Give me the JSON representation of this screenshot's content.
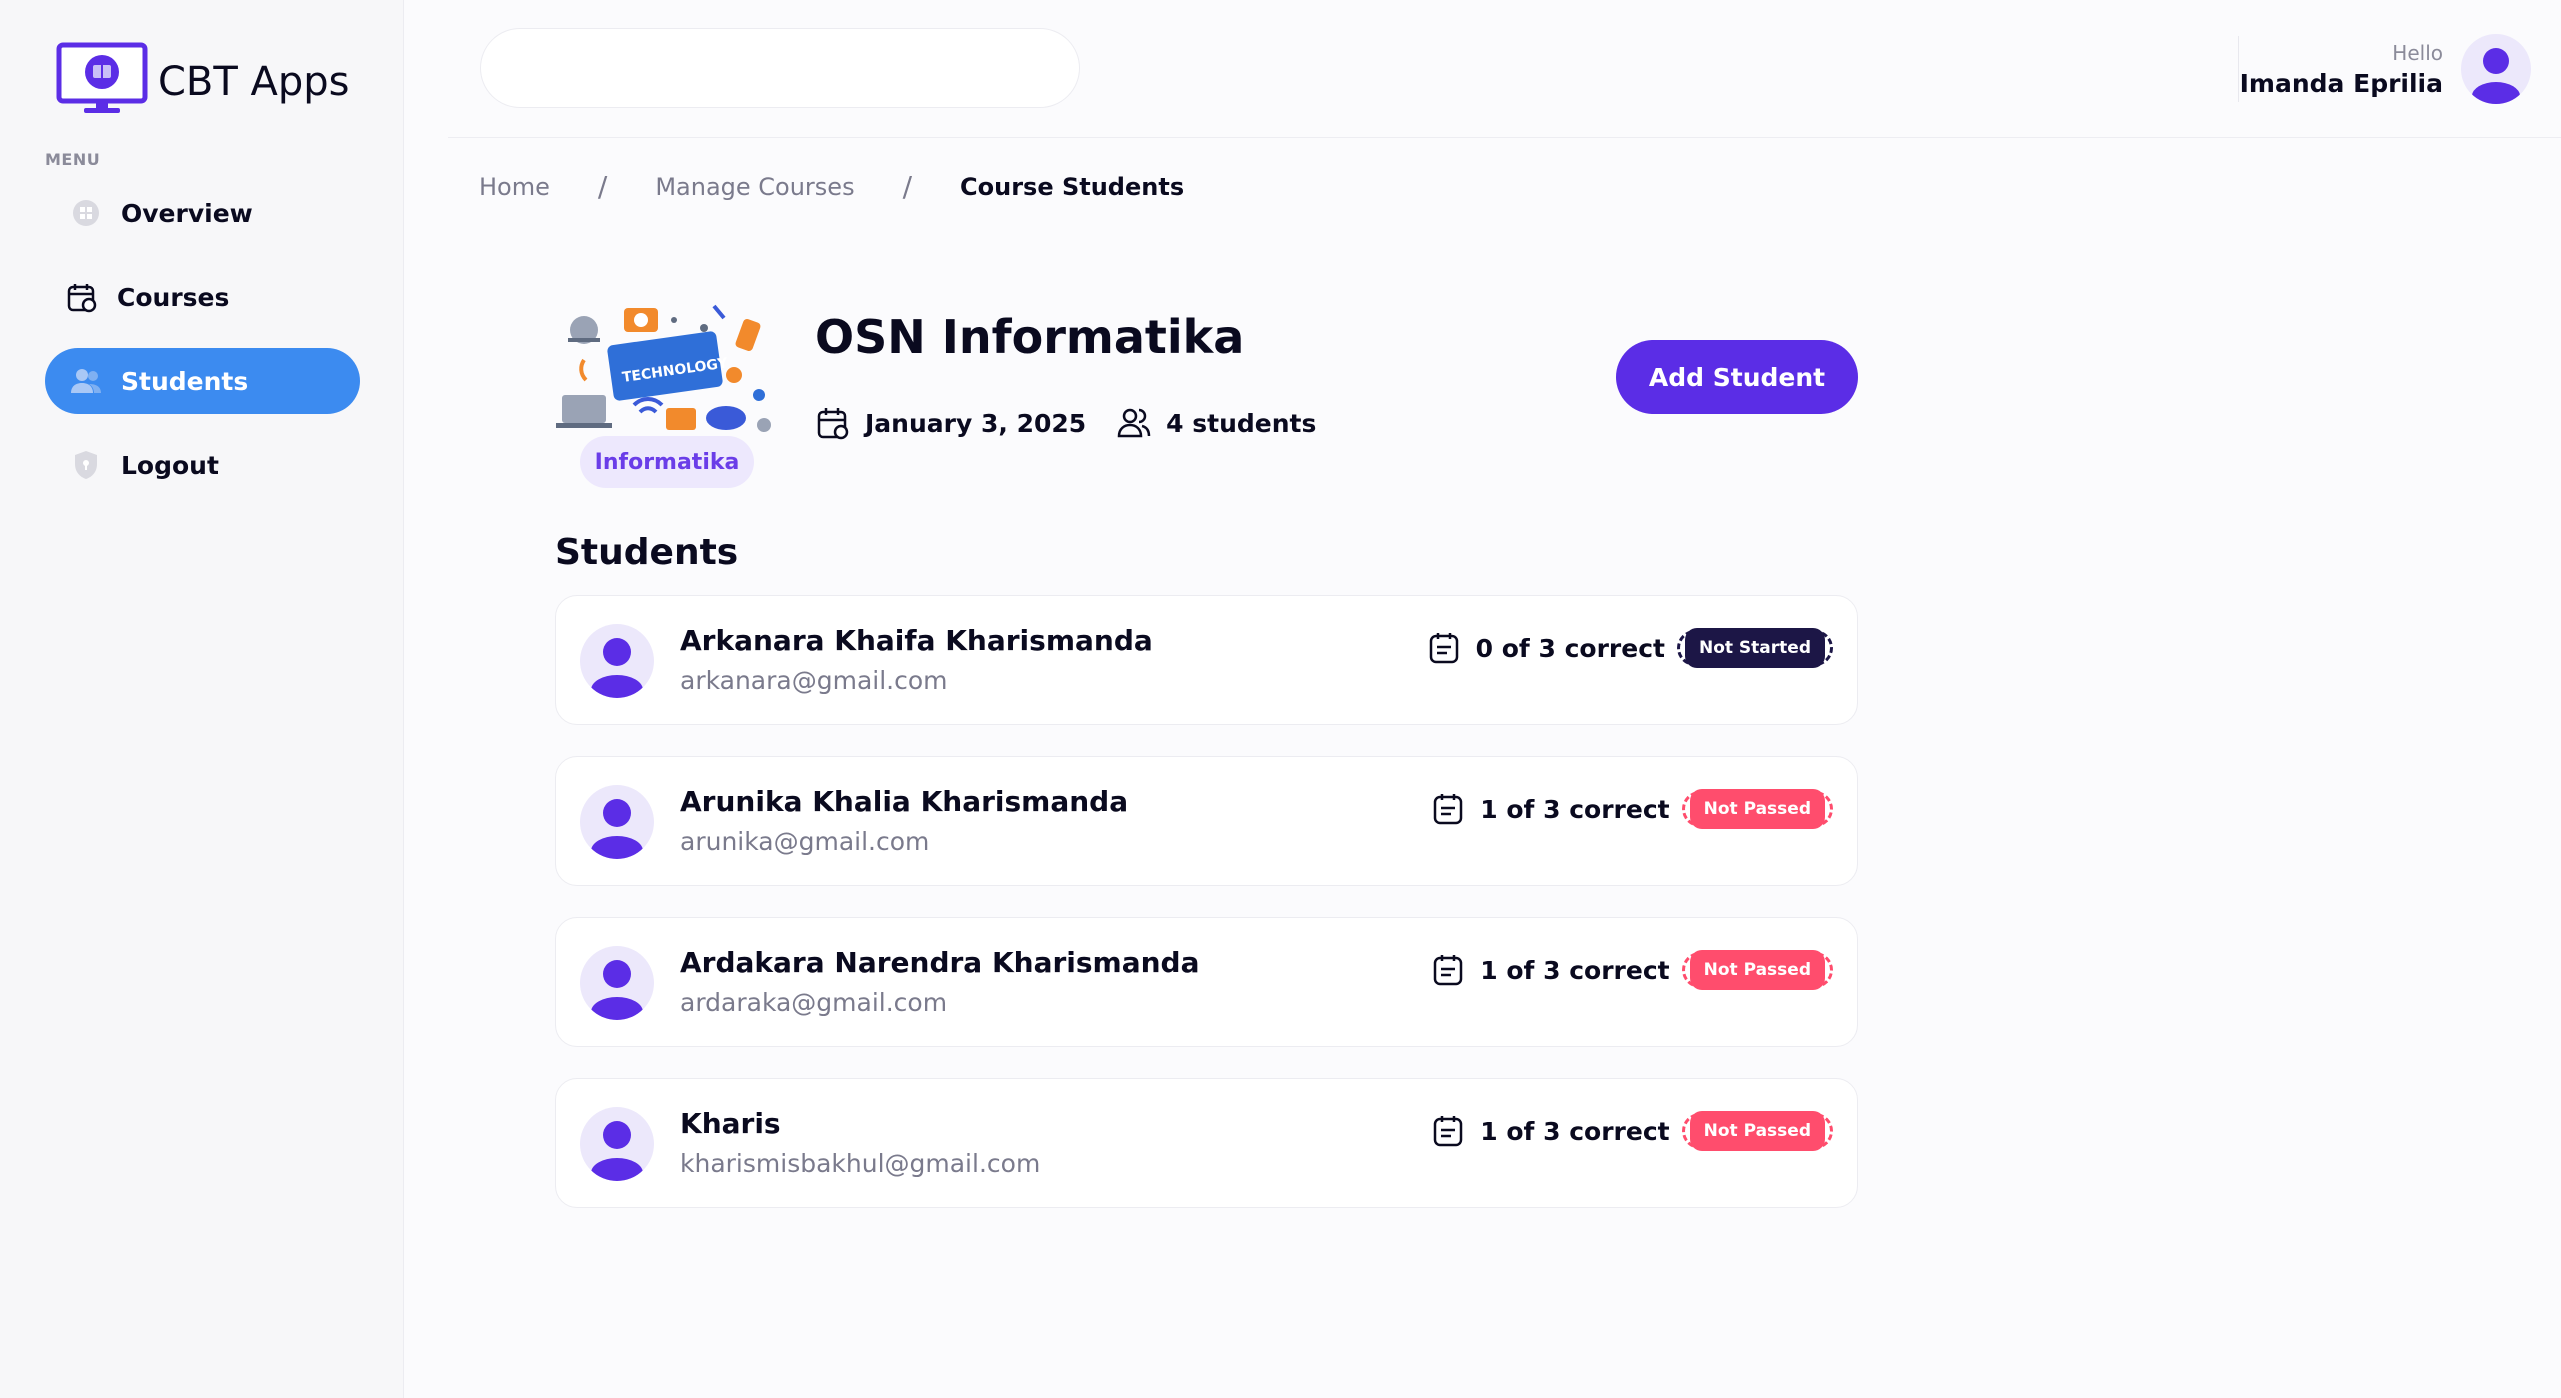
{
  "app": {
    "name": "CBT Apps"
  },
  "sidebar": {
    "menu_label": "MENU",
    "items": [
      {
        "label": "Overview",
        "icon": "grid-icon",
        "active": false
      },
      {
        "label": "Courses",
        "icon": "calendar-icon",
        "active": false
      },
      {
        "label": "Students",
        "icon": "users-icon",
        "active": true
      },
      {
        "label": "Logout",
        "icon": "shield-icon",
        "active": false
      }
    ]
  },
  "header": {
    "search_placeholder": "",
    "greeting": "Hello",
    "user_name": "Imanda Eprilia"
  },
  "breadcrumb": [
    "Home",
    "Manage Courses",
    "Course Students"
  ],
  "course": {
    "title": "OSN Informatika",
    "category": "Informatika",
    "date": "January 3, 2025",
    "students_count": "4 students",
    "thumbnail_text": "TECHNOLOGY"
  },
  "actions": {
    "add_student": "Add Student"
  },
  "students_heading": "Students",
  "students": [
    {
      "name": "Arkanara Khaifa Kharismanda",
      "email": "arkanara@gmail.com",
      "score": "0 of 3 correct",
      "status": "Not Started"
    },
    {
      "name": "Arunika Khalia Kharismanda",
      "email": "arunika@gmail.com",
      "score": "1 of 3 correct",
      "status": "Not Passed"
    },
    {
      "name": "Ardakara Narendra Kharismanda",
      "email": "ardaraka@gmail.com",
      "score": "1 of 3 correct",
      "status": "Not Passed"
    },
    {
      "name": "Kharis",
      "email": "kharismisbakhul@gmail.com",
      "score": "1 of 3 correct",
      "status": "Not Passed"
    }
  ],
  "colors": {
    "primary": "#5b2de6",
    "active_nav": "#3c8bf0",
    "not_started": "#1c1646",
    "not_passed": "#ff4d6d"
  }
}
